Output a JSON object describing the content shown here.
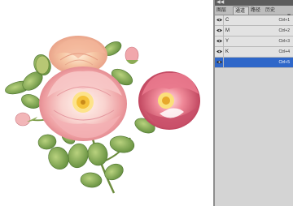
{
  "panel": {
    "collapse_glyph": "◀◀",
    "tabs": [
      "图层",
      "通道",
      "路径",
      "历史"
    ],
    "menu_glyph": "≡"
  },
  "channels": [
    {
      "name": "C",
      "shortcut": "Ctrl+1",
      "selected": false
    },
    {
      "name": "M",
      "shortcut": "Ctrl+2",
      "selected": false
    },
    {
      "name": "Y",
      "shortcut": "Ctrl+3",
      "selected": false
    },
    {
      "name": "K",
      "shortcut": "Ctrl+4",
      "selected": false
    },
    {
      "name": "",
      "shortcut": "Ctrl+5",
      "selected": true
    }
  ],
  "colors": {
    "selection": "#2f67c9",
    "panel_bg": "#d4d4d4",
    "canvas_bg": "#ffffff"
  },
  "icons": [
    "eye-icon",
    "panel-menu-icon",
    "collapse-icon"
  ]
}
